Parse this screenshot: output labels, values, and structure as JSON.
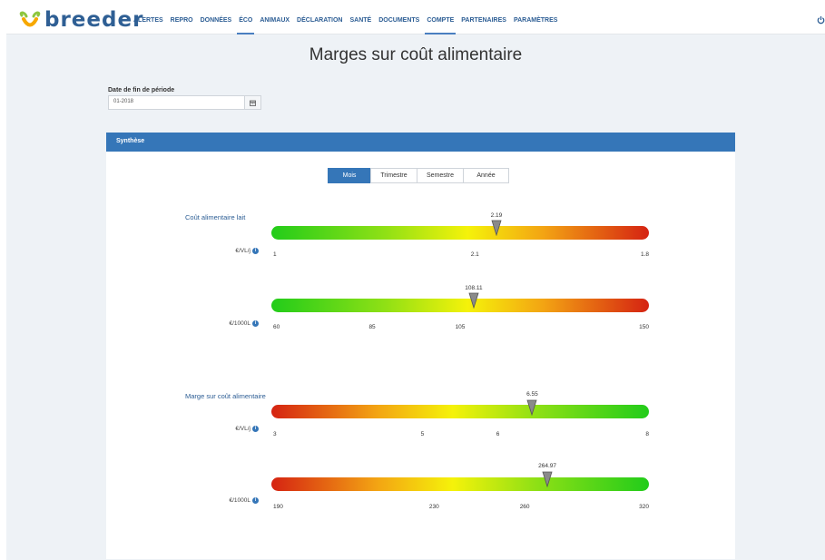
{
  "app": {
    "logo_text": "breeder"
  },
  "nav": {
    "items": [
      {
        "label": "ALERTES",
        "active": false
      },
      {
        "label": "REPRO",
        "active": false
      },
      {
        "label": "DONNÉES",
        "active": false
      },
      {
        "label": "ÉCO",
        "active": true
      },
      {
        "label": "ANIMAUX",
        "active": false
      },
      {
        "label": "DÉCLARATION",
        "active": false
      },
      {
        "label": "SANTÉ",
        "active": false
      },
      {
        "label": "DOCUMENTS",
        "active": false
      },
      {
        "label": "COMPTE",
        "active": true
      },
      {
        "label": "PARTENAIRES",
        "active": false
      },
      {
        "label": "PARAMÈTRES",
        "active": false
      }
    ],
    "power_icon": "power-icon"
  },
  "page": {
    "title": "Marges sur coût alimentaire"
  },
  "date_filter": {
    "label": "Date de fin de période",
    "value": "01-2018",
    "icon": "calendar-icon"
  },
  "panel": {
    "title": "Synthèse",
    "periods": [
      {
        "label": "Mois",
        "active": true
      },
      {
        "label": "Trimestre",
        "active": false
      },
      {
        "label": "Semestre",
        "active": false
      },
      {
        "label": "Année",
        "active": false
      }
    ]
  },
  "groups": [
    {
      "title": "Coût alimentaire lait",
      "gauges": [
        {
          "unit": "€/VL/j",
          "value_label": "2.19",
          "scale": "normal",
          "marker_frac": 0.596,
          "ticks": [
            {
              "label": "1",
              "frac": 0.0
            },
            {
              "label": "2.1",
              "frac": 0.539
            },
            {
              "label": "1.8",
              "frac": 1.0
            }
          ]
        },
        {
          "unit": "€/1000L",
          "value_label": "108.11",
          "scale": "normal",
          "marker_frac": 0.536,
          "ticks": [
            {
              "label": "60",
              "frac": 0.0
            },
            {
              "label": "85",
              "frac": 0.267
            },
            {
              "label": "105",
              "frac": 0.5
            },
            {
              "label": "150",
              "frac": 1.0
            }
          ]
        }
      ]
    },
    {
      "title": "Marge sur coût alimentaire",
      "gauges": [
        {
          "unit": "€/VL/j",
          "value_label": "6.55",
          "scale": "reverse",
          "marker_frac": 0.691,
          "ticks": [
            {
              "label": "3",
              "frac": 0.0
            },
            {
              "label": "5",
              "frac": 0.4
            },
            {
              "label": "6",
              "frac": 0.6
            },
            {
              "label": "8",
              "frac": 1.0
            }
          ]
        },
        {
          "unit": "€/1000L",
          "value_label": "264.97",
          "scale": "reverse",
          "marker_frac": 0.731,
          "ticks": [
            {
              "label": "190",
              "frac": 0.0
            },
            {
              "label": "230",
              "frac": 0.431
            },
            {
              "label": "260",
              "frac": 0.671
            },
            {
              "label": "320",
              "frac": 1.0
            }
          ]
        }
      ]
    }
  ]
}
